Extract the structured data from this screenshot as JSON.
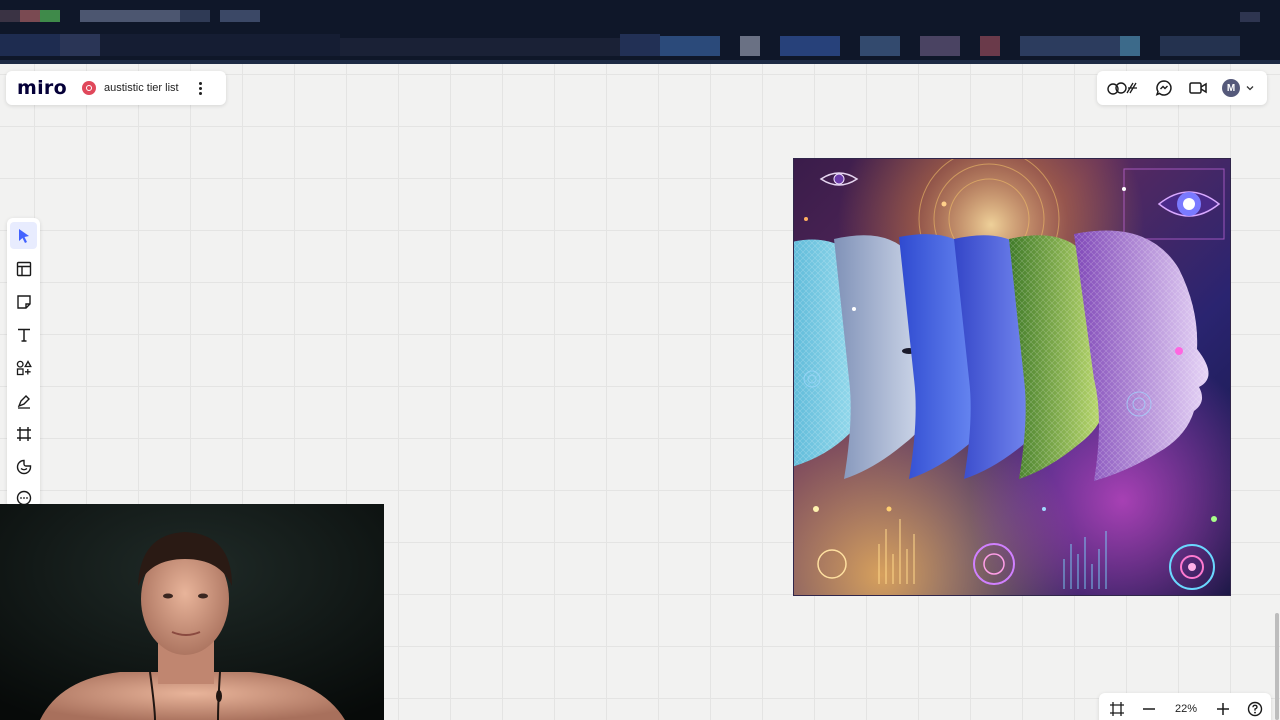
{
  "app": {
    "logo_text": "miro",
    "board_title": "austistic tier list"
  },
  "header": {
    "reactions_icon": "reactions-icon",
    "chat_icon": "chat-icon",
    "video_icon": "video-icon",
    "avatar_initial": "M"
  },
  "toolbar": {
    "tools": [
      "select-tool",
      "templates-tool",
      "sticky-note-tool",
      "text-tool",
      "shapes-tool",
      "pen-tool",
      "frame-tool",
      "reactions-tool",
      "comment-tool"
    ],
    "active_tool": "select-tool"
  },
  "zoom": {
    "level": "22%"
  },
  "colors": {
    "accent": "#4262ff",
    "board_icon": "#e0485b",
    "logo": "#050038",
    "canvas": "#f2f2f1"
  }
}
